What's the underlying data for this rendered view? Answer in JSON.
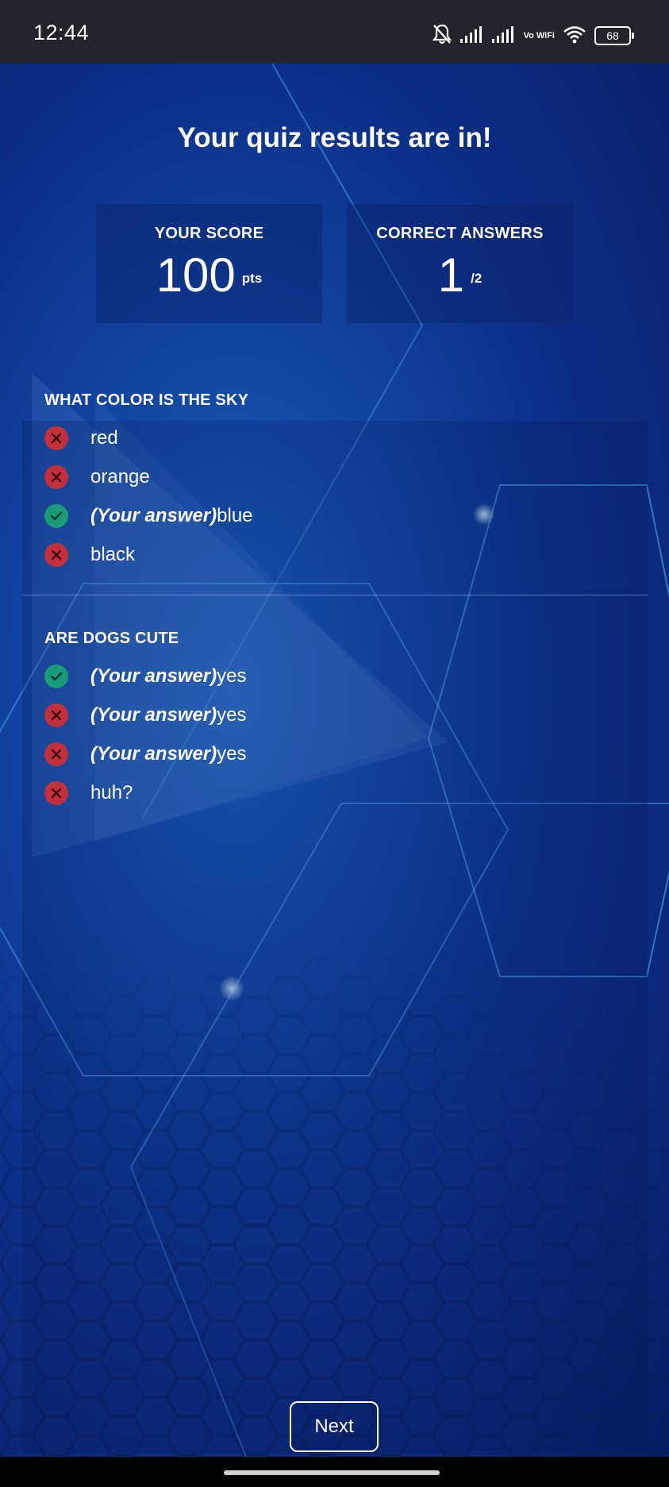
{
  "status_bar": {
    "time": "12:44",
    "vowifi": "Vo WiFi",
    "battery": "68"
  },
  "page": {
    "title": "Your quiz results are in!"
  },
  "stats": {
    "score_label": "YOUR SCORE",
    "score_value": "100",
    "score_unit": "pts",
    "correct_label": "CORRECT ANSWERS",
    "correct_value": "1",
    "correct_total": "/2"
  },
  "questions": [
    {
      "title": "WHAT COLOR IS THE SKY",
      "answers": [
        {
          "prefix": "",
          "text": "red",
          "status": "wrong"
        },
        {
          "prefix": "",
          "text": "orange",
          "status": "wrong"
        },
        {
          "prefix": "(Your answer)",
          "text": "blue",
          "status": "correct"
        },
        {
          "prefix": "",
          "text": "black",
          "status": "wrong"
        }
      ]
    },
    {
      "title": "ARE DOGS CUTE",
      "answers": [
        {
          "prefix": "(Your answer)",
          "text": "yes",
          "status": "correct"
        },
        {
          "prefix": "(Your answer)",
          "text": "yes",
          "status": "wrong"
        },
        {
          "prefix": "(Your answer)",
          "text": "yes",
          "status": "wrong"
        },
        {
          "prefix": "",
          "text": "huh?",
          "status": "wrong"
        }
      ]
    }
  ],
  "next_button": {
    "label": "Next"
  },
  "colors": {
    "correct": "#1a9b78",
    "wrong": "#c2303b",
    "status_bar": "#23242b"
  }
}
